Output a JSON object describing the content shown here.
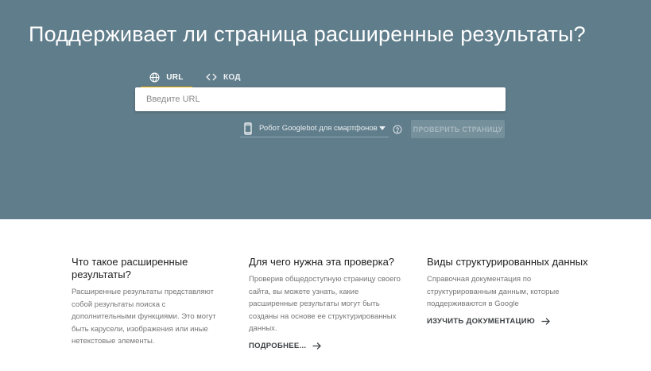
{
  "hero": {
    "title": "Поддерживает ли страница расширенные результаты?",
    "background_color": "#607d8b"
  },
  "tabs": [
    {
      "label": "URL",
      "icon": "globe-icon",
      "active": true
    },
    {
      "label": "КОД",
      "icon": "code-icon",
      "active": false
    }
  ],
  "url_input": {
    "placeholder": "Введите URL",
    "value": ""
  },
  "device_select": {
    "icon": "smartphone-icon",
    "selected": "Робот Googlebot для смартфонов"
  },
  "check_button": {
    "label": "ПРОВЕРИТЬ СТРАНИЦУ",
    "disabled": true
  },
  "info_sections": [
    {
      "heading": "Что такое расширенные результаты?",
      "text": "Расширенные результаты представляют собой результаты поиска с дополнительными функциями. Это могут быть карусели, изображения или иные нетекстовые элементы.",
      "link": ""
    },
    {
      "heading": "Для чего нужна эта проверка?",
      "text": "Проверив общедоступную страницу своего сайта, вы можете узнать, какие расширенные результаты могут быть созданы на основе ее структурированных данных.",
      "link": "ПОДРОБНЕЕ..."
    },
    {
      "heading": "Виды структурированных данных",
      "text": "Справочная документация по структурированным данным, которые поддерживаются в Google",
      "link": "ИЗУЧИТЬ ДОКУМЕНТАЦИЮ"
    }
  ],
  "colors": {
    "accent_underline": "#f4b400",
    "text_primary": "#212121",
    "text_secondary": "#757575"
  }
}
